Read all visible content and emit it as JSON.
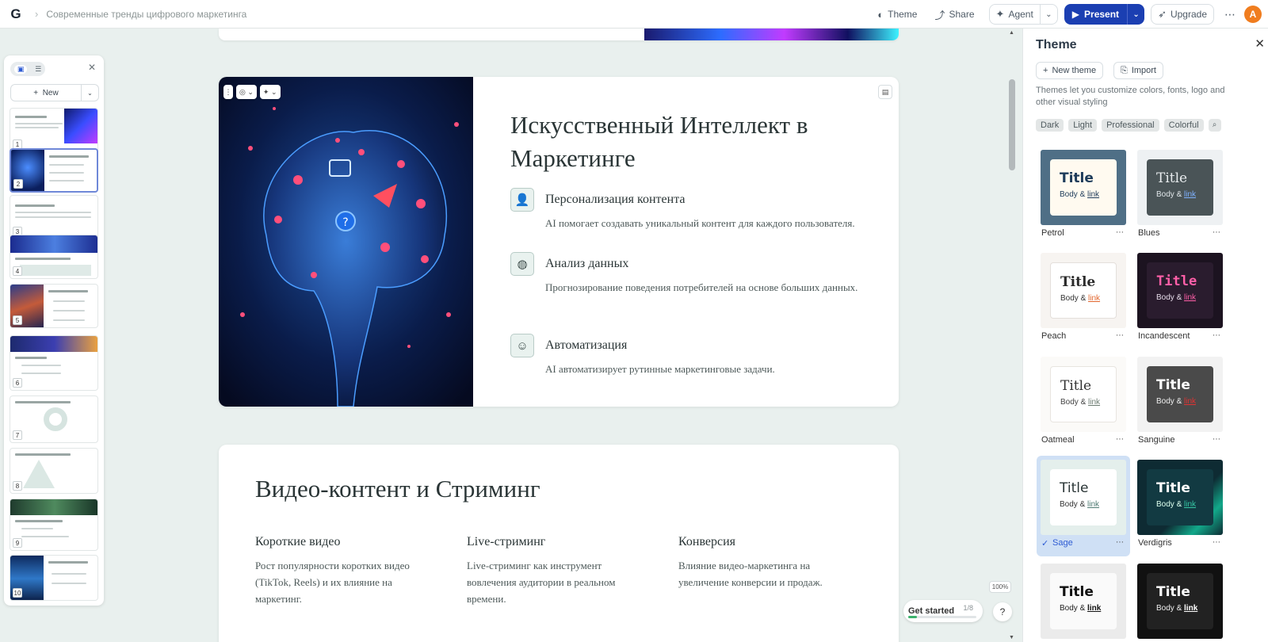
{
  "topbar": {
    "logo": "G",
    "breadcrumb": "Современные тренды цифрового маркетинга",
    "theme": "Theme",
    "share": "Share",
    "agent": "Agent",
    "present": "Present",
    "upgrade": "Upgrade",
    "avatar": "A"
  },
  "sidebar": {
    "new_label": "New",
    "slides": [
      "1",
      "2",
      "3",
      "4",
      "5",
      "6",
      "7",
      "8",
      "9",
      "10"
    ]
  },
  "slide": {
    "title": "Искусственный Интеллект в Маркетинге",
    "features": [
      {
        "heading": "Персонализация контента",
        "text": "AI помогает создавать уникальный контент для каждого пользователя."
      },
      {
        "heading": "Анализ данных",
        "text": "Прогнозирование поведения потребителей на основе больших данных."
      },
      {
        "heading": "Автоматизация",
        "text": "AI автоматизирует рутинные маркетинговые задачи."
      }
    ]
  },
  "slide2": {
    "title": "Видео-контент и Стриминг",
    "columns": [
      {
        "heading": "Короткие видео",
        "text": "Рост популярности коротких видео (TikTok, Reels) и их влияние на маркетинг."
      },
      {
        "heading": "Live-стриминг",
        "text": "Live-стриминг как инструмент вовлечения аудитории в реальном времени."
      },
      {
        "heading": "Конверсия",
        "text": "Влияние видео-маркетинга на увеличение конверсии и продаж."
      }
    ]
  },
  "get_started": {
    "label": "Get started",
    "progress_text": "1/8",
    "progress": 0.125
  },
  "zoom": "100%",
  "help": "?",
  "theme_panel": {
    "title": "Theme",
    "new_theme": "New theme",
    "import": "Import",
    "description": "Themes let you customize colors, fonts, logo and other visual styling",
    "tags": [
      "Dark",
      "Light",
      "Professional",
      "Colorful"
    ],
    "themes": [
      {
        "name": "Petrol",
        "title": "Title",
        "body": "Body & ",
        "link": "link",
        "selected": false
      },
      {
        "name": "Blues",
        "title": "Title",
        "body": "Body & ",
        "link": "link",
        "selected": false
      },
      {
        "name": "Peach",
        "title": "Title",
        "body": "Body & ",
        "link": "link",
        "selected": false
      },
      {
        "name": "Incandescent",
        "title": "Title",
        "body": "Body & ",
        "link": "link",
        "selected": false
      },
      {
        "name": "Oatmeal",
        "title": "Title",
        "body": "Body & ",
        "link": "link",
        "selected": false
      },
      {
        "name": "Sanguine",
        "title": "Title",
        "body": "Body & ",
        "link": "link",
        "selected": false
      },
      {
        "name": "Sage",
        "title": "Title",
        "body": "Body & ",
        "link": "link",
        "selected": true
      },
      {
        "name": "Verdigris",
        "title": "Title",
        "body": "Body & ",
        "link": "link",
        "selected": false
      },
      {
        "name": "",
        "title": "Title",
        "body": "Body & ",
        "link": "link",
        "selected": false
      },
      {
        "name": "",
        "title": "Title",
        "body": "Body & ",
        "link": "link",
        "selected": false
      }
    ]
  },
  "colors": {
    "accent": "#1b3fb2",
    "avatar": "#f07d1f",
    "canvas_bg": "#e9f0ee",
    "selected_theme": "#cfe0f5"
  }
}
